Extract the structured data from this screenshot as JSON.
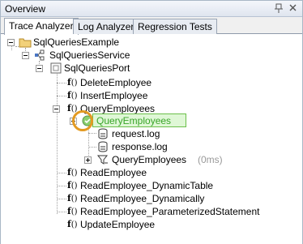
{
  "header": {
    "title": "Overview",
    "pin_icon": "pin-icon",
    "close_icon": "close-icon"
  },
  "tabs": [
    {
      "label": "Trace Analyzer",
      "active": true
    },
    {
      "label": "Log Analyzer",
      "active": false
    },
    {
      "label": "Regression Tests",
      "active": false
    }
  ],
  "tree": {
    "project": "SqlQueriesExample",
    "service": "SqlQueriesService",
    "port": "SqlQueriesPort",
    "operations": [
      "DeleteEmployee",
      "InsertEmployee",
      "QueryEmployees",
      "ReadEmployee",
      "ReadEmployee_DynamicTable",
      "ReadEmployee_Dynamically",
      "ReadEmployee_ParameterizedStatement",
      "UpdateEmployee"
    ],
    "selected_node": "QueryEmployees",
    "children": {
      "request": "request.log",
      "response": "response.log",
      "sub_call": "QueryEmployees",
      "sub_call_time": "(0ms)"
    },
    "fx_label": "f",
    "fx_paren": "()"
  },
  "colors": {
    "selection_fill": "#dff7d6",
    "selection_border": "#6bbf4a",
    "highlight_ring": "#e39a22"
  }
}
